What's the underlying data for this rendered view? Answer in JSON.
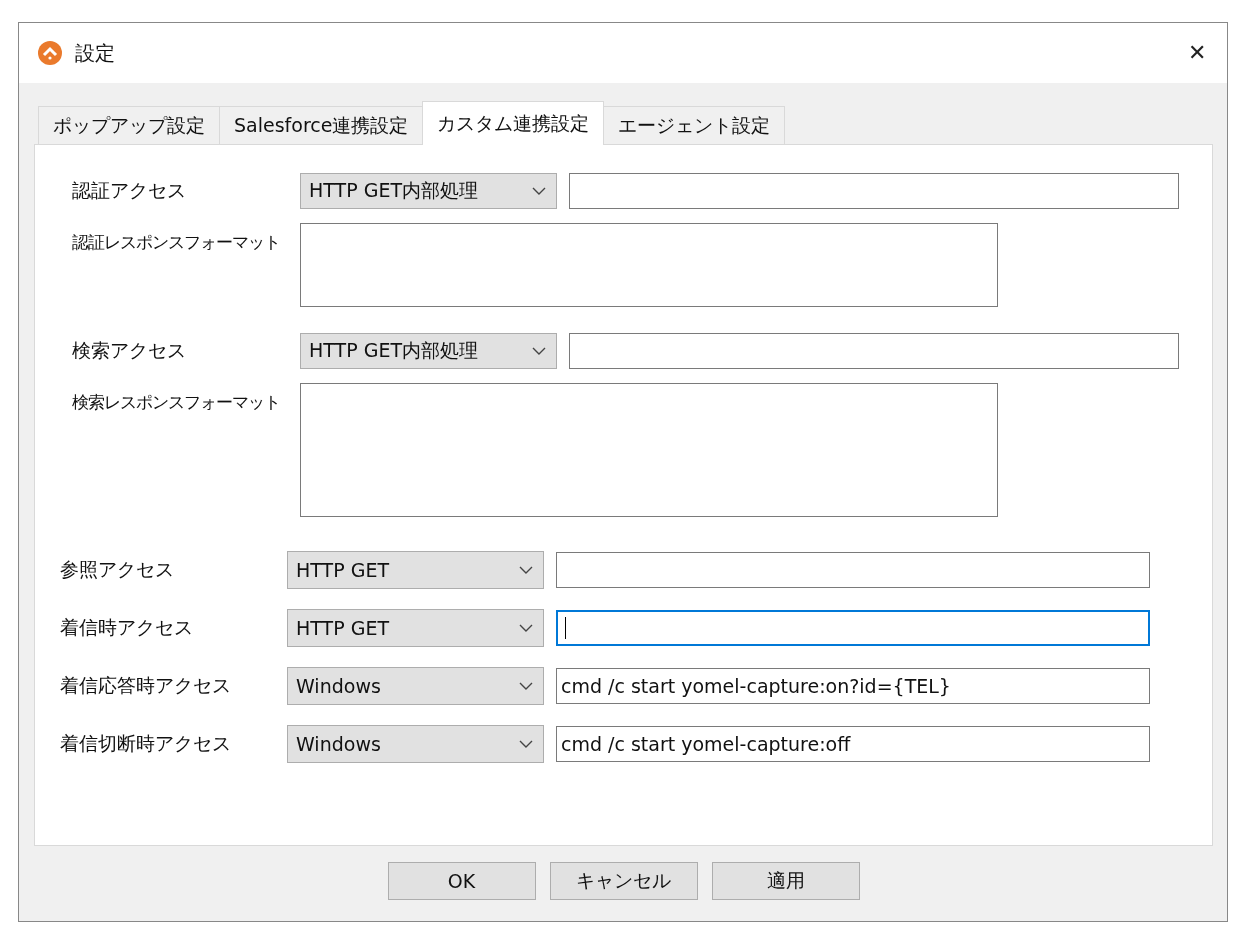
{
  "window": {
    "title": "設定",
    "close": "✕"
  },
  "tabs": [
    {
      "label": "ポップアップ設定",
      "selected": false
    },
    {
      "label": "Salesforce連携設定",
      "selected": false
    },
    {
      "label": "カスタム連携設定",
      "selected": true
    },
    {
      "label": "エージェント設定",
      "selected": false
    }
  ],
  "custom_rows": [
    {
      "kind": "access",
      "label": "認証アクセス",
      "combo": "HTTP GET内部処理"
    },
    {
      "kind": "format",
      "label": "認証レスポンスフォーマット"
    },
    {
      "kind": "access",
      "label": "検索アクセス",
      "combo": "HTTP GET内部処理"
    },
    {
      "kind": "format",
      "label": "検索レスポンスフォーマット"
    }
  ],
  "call_rows": [
    {
      "label": "参照アクセス",
      "combo": "HTTP GET",
      "focused": false
    },
    {
      "label": "着信時アクセス",
      "combo": "HTTP GET",
      "focused": true
    },
    {
      "label": "着信応答時アクセス",
      "combo": "Windows",
      "value": "cmd /c start yomel-capture:on?id={TEL}",
      "focused": false
    },
    {
      "label": "着信切断時アクセス",
      "combo": "Windows",
      "value": "cmd /c start yomel-capture:off",
      "focused": false
    }
  ],
  "buttons": [
    "OK",
    "キャンセル",
    "適用"
  ]
}
